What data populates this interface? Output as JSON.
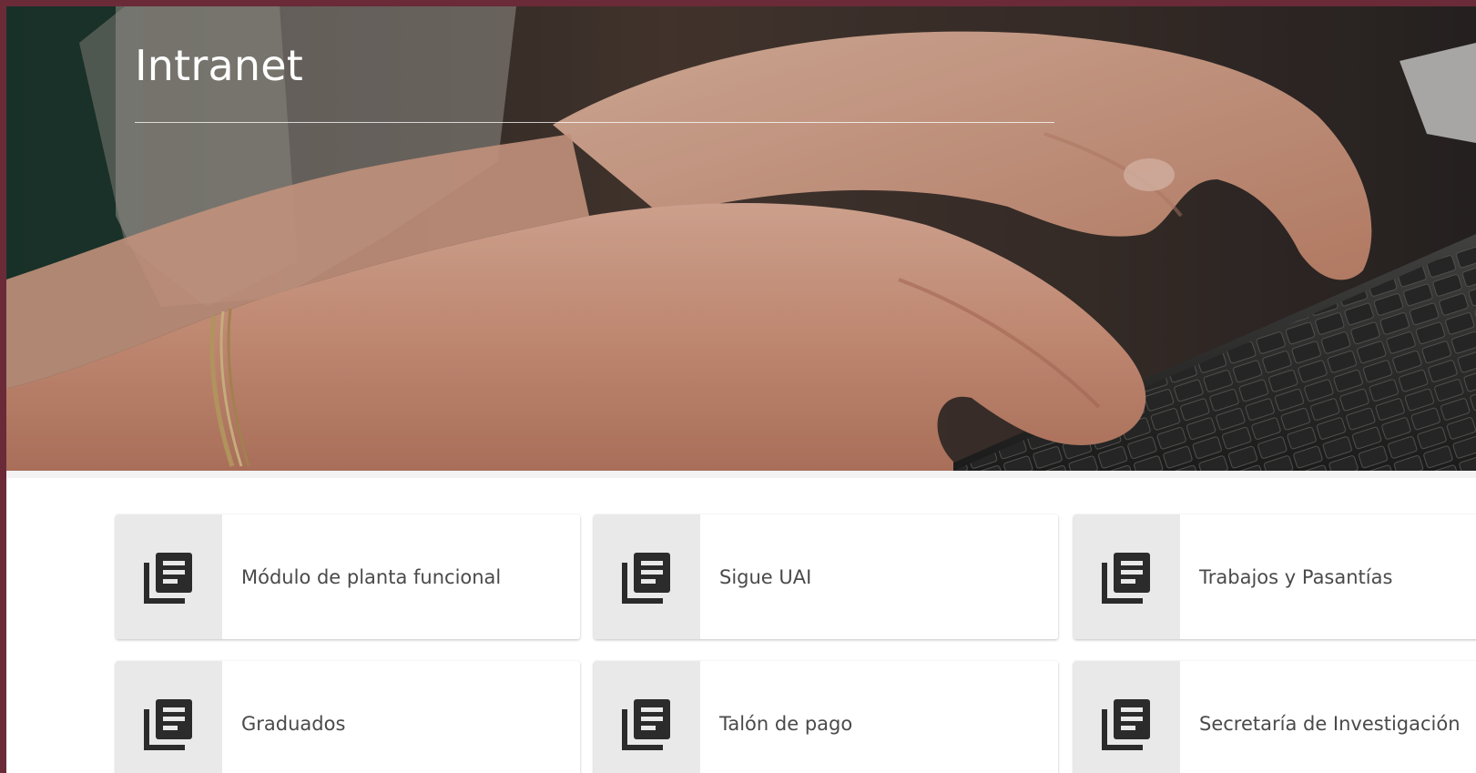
{
  "page": {
    "title": "Intranet",
    "frame_color": "#6b2a38"
  },
  "cards": [
    {
      "label": "Módulo de planta funcional",
      "icon": "library-books-icon"
    },
    {
      "label": "Sigue UAI",
      "icon": "library-books-icon"
    },
    {
      "label": "Trabajos y Pasantías",
      "icon": "library-books-icon"
    },
    {
      "label": "Graduados",
      "icon": "library-books-icon"
    },
    {
      "label": "Talón de pago",
      "icon": "library-books-icon"
    },
    {
      "label": "Secretaría de Investigación",
      "icon": "library-books-icon"
    }
  ]
}
